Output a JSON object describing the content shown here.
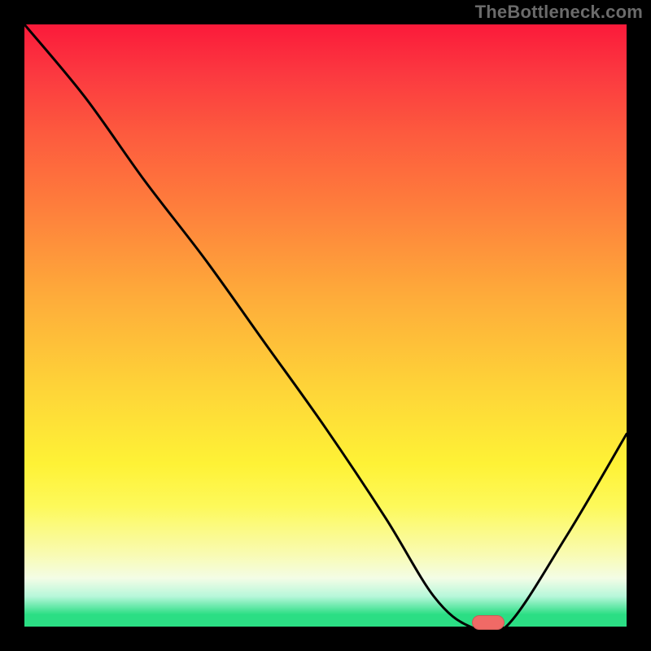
{
  "watermark": "TheBottleneck.com",
  "chart_data": {
    "type": "line",
    "title": "",
    "xlabel": "",
    "ylabel": "",
    "xlim": [
      0,
      100
    ],
    "ylim": [
      0,
      100
    ],
    "grid": false,
    "series": [
      {
        "name": "curve",
        "x": [
          0,
          10,
          20,
          30,
          40,
          50,
          60,
          68,
          74,
          80,
          90,
          100
        ],
        "y": [
          100,
          88,
          74,
          61,
          47,
          33,
          18,
          5,
          0,
          0,
          15,
          32
        ]
      }
    ],
    "marker": {
      "x": 77,
      "y": 0.7
    },
    "background_gradient": {
      "top_color": "#fb1a3a",
      "mid_color": "#fef236",
      "bottom_color": "#2bde84"
    },
    "line_color": "#000000",
    "marker_color": "#f06a66"
  }
}
